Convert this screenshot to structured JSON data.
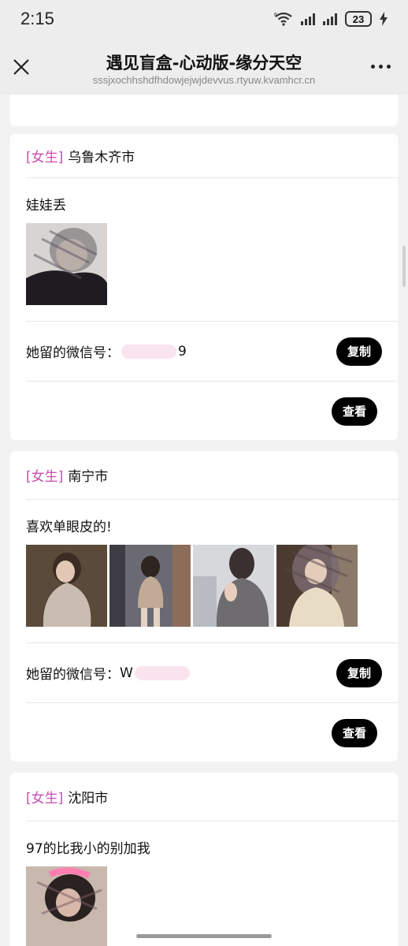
{
  "status": {
    "time": "2:15",
    "battery": "23",
    "wifi_label": "6"
  },
  "nav": {
    "title": "遇见盲盒-心动版-缘分天空",
    "url": "sssjxochhshdfhdowjejwjdevvus.rtyuw.kvamhcr.cn"
  },
  "cards": [
    {
      "tag": "[女生]",
      "city": "乌鲁木齐市",
      "message": "娃娃丢",
      "photos": [
        "photo-1"
      ],
      "wechat_label": "她留的微信号：",
      "wechat_suffix": "9",
      "copy_label": "复制",
      "view_label": "查看"
    },
    {
      "tag": "[女生]",
      "city": "南宁市",
      "message": "喜欢单眼皮的!",
      "photos": [
        "photo-1",
        "photo-2",
        "photo-3",
        "photo-4"
      ],
      "wechat_label": "她留的微信号：",
      "wechat_suffix": "W",
      "copy_label": "复制",
      "view_label": "查看"
    },
    {
      "tag": "[女生]",
      "city": "沈阳市",
      "message": "97的比我小的别加我",
      "photos": [
        "photo-1"
      ]
    }
  ],
  "colors": {
    "tag": "#c64fb0",
    "button": "#000000",
    "background": "#f2f2f2"
  }
}
